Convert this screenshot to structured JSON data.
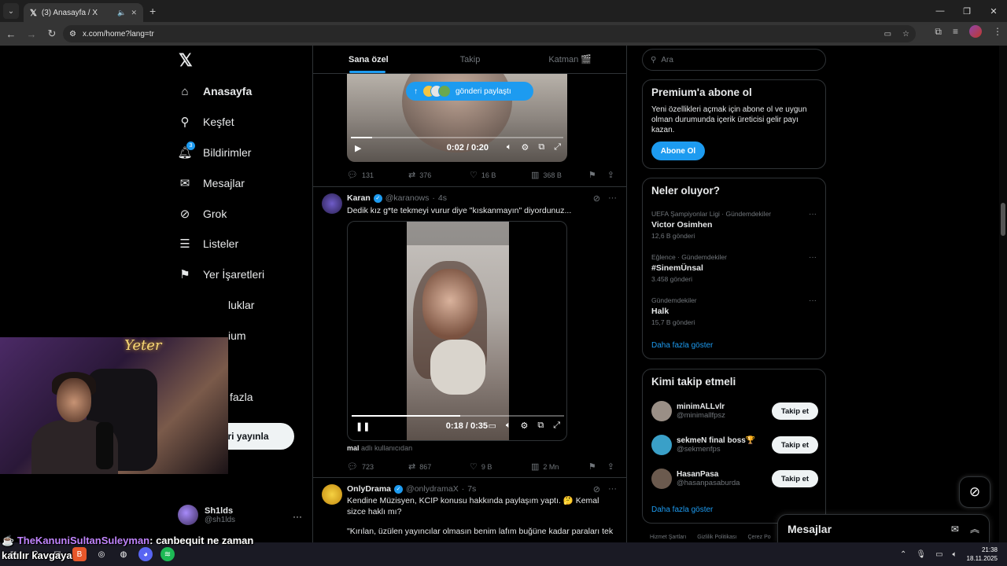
{
  "browser": {
    "tab_title": "(3) Anasayfa / X",
    "url": "x.com/home?lang=tr"
  },
  "nav": {
    "items": [
      {
        "label": "Anasayfa",
        "icon": "home-icon",
        "active": true
      },
      {
        "label": "Keşfet",
        "icon": "search-icon"
      },
      {
        "label": "Bildirimler",
        "icon": "bell-icon",
        "badge": "3"
      },
      {
        "label": "Mesajlar",
        "icon": "mail-icon"
      },
      {
        "label": "Grok",
        "icon": "grok-icon"
      },
      {
        "label": "Listeler",
        "icon": "list-icon"
      },
      {
        "label": "Yer İşaretleri",
        "icon": "bookmark-icon"
      },
      {
        "label": "luklar",
        "icon": "community-icon"
      },
      {
        "label": "ium",
        "icon": "premium-icon"
      },
      {
        "label": "fazla",
        "icon": "more-icon"
      }
    ],
    "post_button": "Gönderi yayınla",
    "profile": {
      "name": "Sh1lds",
      "handle": "@sh1lds"
    }
  },
  "feed": {
    "tabs": [
      "Sana özel",
      "Takip",
      "Katman 🎬"
    ],
    "share_pill": "gönderi paylaştı",
    "tweet1": {
      "video_time": "0:02 / 0:20",
      "progress": 0.1,
      "stats": {
        "replies": "131",
        "reposts": "376",
        "likes": "16 B",
        "views": "368 B"
      }
    },
    "tweet2": {
      "name": "Karan",
      "handle": "@karanows",
      "time": "4s",
      "text": "Dedik kız g*te tekmeyi vurur diye \"kıskanmayın\" diyordunuz...",
      "video_time": "0:18 / 0:35",
      "progress": 0.51,
      "mention_user": "mal",
      "mention_suffix": "adlı kullanıcıdan",
      "stats": {
        "replies": "723",
        "reposts": "867",
        "likes": "9 B",
        "views": "2 Mn"
      }
    },
    "tweet3": {
      "name": "OnlyDrama",
      "handle": "@onlydramaX",
      "time": "7s",
      "text1": "Kendine Müzisyen, KCIP konusu hakkında paylaşım yaptı. 🤔 Kemal sizce haklı mı?",
      "text2": "\"Kırılan, üzülen yayıncılar olmasın benim lafım buğüne kadar paraları tek"
    }
  },
  "sidebar": {
    "search_placeholder": "Ara",
    "premium": {
      "title": "Premium'a abone ol",
      "desc": "Yeni özellikleri açmak için abone ol ve uygun olman durumunda içerik üreticisi gelir payı kazan.",
      "button": "Abone Ol"
    },
    "trends_title": "Neler oluyor?",
    "trends": [
      {
        "category": "UEFA Şampiyonlar Ligi · Gündemdekiler",
        "title": "Victor Osimhen",
        "count": "12,6 B gönderi"
      },
      {
        "category": "Eğlence · Gündemdekiler",
        "title": "#SinemÜnsal",
        "count": "3.458 gönderi"
      },
      {
        "category": "Gündemdekiler",
        "title": "Halk",
        "count": "15,7 B gönderi"
      }
    ],
    "show_more": "Daha fazla göster",
    "who_title": "Kimi takip etmeli",
    "who": [
      {
        "name": "minimALLvlr",
        "handle": "@minimallfpsz",
        "color": "#9a8f86"
      },
      {
        "name": "sekmeN final boss🏆",
        "handle": "@sekmenfps",
        "color": "#3aa0c8"
      },
      {
        "name": "HasanPasa",
        "handle": "@hasanpasaburda",
        "color": "#6b5a4e"
      }
    ],
    "follow_label": "Takip et",
    "footer": [
      "Hizmet Şartları",
      "Gizlilik Politikası",
      "Çerez Po"
    ]
  },
  "messages_dock": {
    "title": "Mesajlar"
  },
  "stream_chat": {
    "user": "TheKanuniSultanSuleyman",
    "message_part1": ": canbequit ne zaman",
    "message_part2": "katılır kavgaya"
  },
  "taskbar": {
    "time": "21:38",
    "date": "18.11.2025"
  }
}
